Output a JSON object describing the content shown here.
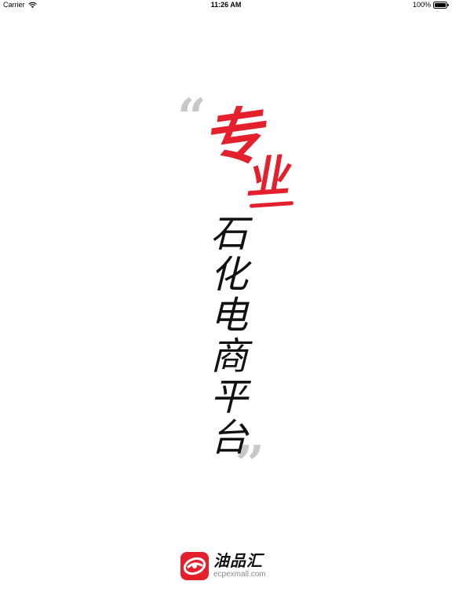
{
  "status_bar": {
    "carrier": "Carrier",
    "time": "11:26 AM",
    "battery": "100%"
  },
  "slogan": {
    "quote_open": "“",
    "quote_close": "”",
    "red_chars": [
      "专",
      "业"
    ],
    "black_chars": [
      "石",
      "化",
      "电",
      "商",
      "平",
      "台"
    ]
  },
  "logo": {
    "name": "油品汇",
    "url": "ecpexmall.com"
  },
  "icons": [
    "wifi-icon",
    "battery-icon",
    "logo-mark-icon"
  ],
  "colors": {
    "brand_red": "#e3202b",
    "quote_gray": "#c8c8c8",
    "text_black": "#111111",
    "url_gray": "#8a8a8a",
    "background": "#ffffff"
  }
}
